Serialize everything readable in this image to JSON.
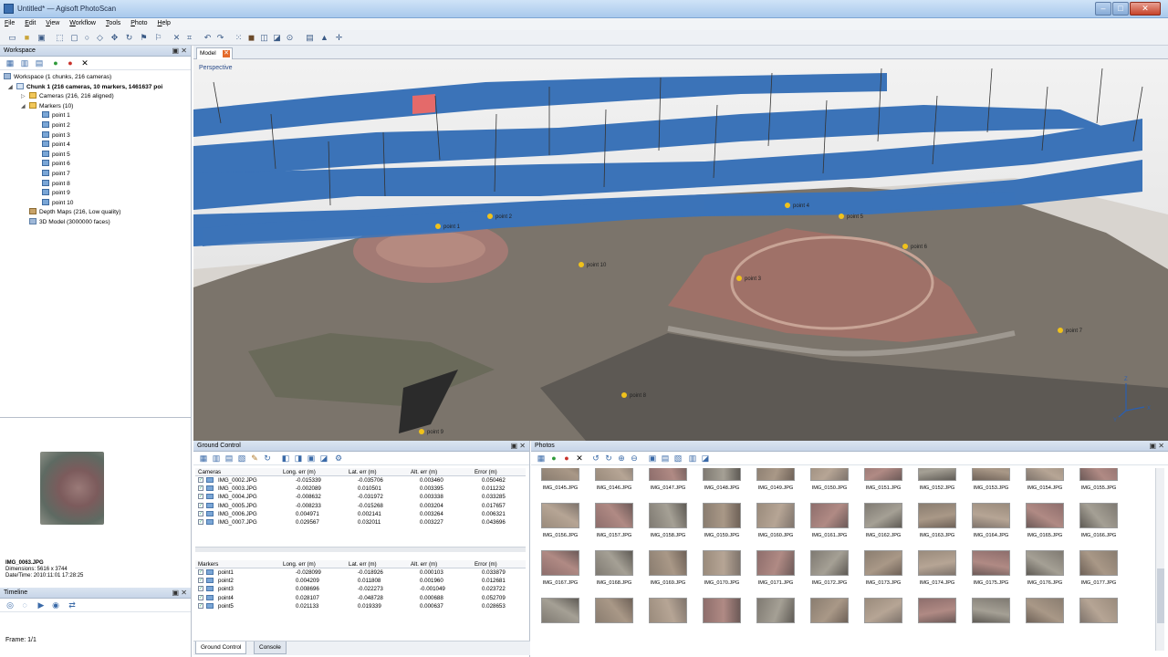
{
  "window": {
    "title": "Untitled* — Agisoft PhotoScan"
  },
  "menu": [
    "File",
    "Edit",
    "View",
    "Workflow",
    "Tools",
    "Photo",
    "Help"
  ],
  "workspace": {
    "title": "Workspace",
    "tree": [
      {
        "label": "Workspace (1 chunks, 216 cameras)",
        "level": 0,
        "bold": false
      },
      {
        "label": "Chunk 1 (216 cameras, 10 markers, 1461637 poi",
        "level": 1,
        "bold": true
      },
      {
        "label": "Cameras (216, 216 aligned)",
        "level": 2,
        "bold": false
      },
      {
        "label": "Markers (10)",
        "level": 2,
        "bold": false
      },
      {
        "label": "point 1",
        "level": 3,
        "bold": false
      },
      {
        "label": "point 2",
        "level": 3,
        "bold": false
      },
      {
        "label": "point 3",
        "level": 3,
        "bold": false
      },
      {
        "label": "point 4",
        "level": 3,
        "bold": false
      },
      {
        "label": "point 5",
        "level": 3,
        "bold": false
      },
      {
        "label": "point 6",
        "level": 3,
        "bold": false
      },
      {
        "label": "point 7",
        "level": 3,
        "bold": false
      },
      {
        "label": "point 8",
        "level": 3,
        "bold": false
      },
      {
        "label": "point 9",
        "level": 3,
        "bold": false
      },
      {
        "label": "point 10",
        "level": 3,
        "bold": false
      },
      {
        "label": "Depth Maps (216, Low quality)",
        "level": 2,
        "bold": false
      },
      {
        "label": "3D Model (3000000 faces)",
        "level": 2,
        "bold": false
      }
    ]
  },
  "preview": {
    "name": "IMG_0063.JPG",
    "dimensions": "Dimensions: 5616 x 3744",
    "datetime": "Date/Time: 2010:11:01 17:28:25"
  },
  "timeline": {
    "title": "Timeline",
    "frames": "Frame: 1/1"
  },
  "model": {
    "tab": "Model",
    "view_label": "Perspective"
  },
  "ground_control": {
    "title": "Ground Control",
    "cameras_headers": [
      "Cameras",
      "Long. err (m)",
      "Lat. err (m)",
      "Alt. err (m)",
      "Error (m)"
    ],
    "cameras_rows": [
      [
        "IMG_0002.JPG",
        "-0.015339",
        "-0.035706",
        "0.003460",
        "0.050462"
      ],
      [
        "IMG_0003.JPG",
        "-0.002089",
        "0.010501",
        "0.003395",
        "0.011232"
      ],
      [
        "IMG_0004.JPG",
        "-0.008632",
        "-0.031972",
        "0.003338",
        "0.033285"
      ],
      [
        "IMG_0005.JPG",
        "-0.008233",
        "-0.015268",
        "0.003204",
        "0.017657"
      ],
      [
        "IMG_0006.JPG",
        "0.004971",
        "0.002141",
        "0.003264",
        "0.006321"
      ],
      [
        "IMG_0007.JPG",
        "0.029567",
        "0.032011",
        "0.003227",
        "0.043696"
      ]
    ],
    "markers_headers": [
      "Markers",
      "Long. err (m)",
      "Lat. err (m)",
      "Alt. err (m)",
      "Error (m)"
    ],
    "markers_rows": [
      [
        "point1",
        "-0.028099",
        "-0.018926",
        "0.000103",
        "0.033879"
      ],
      [
        "point2",
        "0.004209",
        "0.011808",
        "0.001960",
        "0.012681"
      ],
      [
        "point3",
        "0.008696",
        "-0.022273",
        "-0.001049",
        "0.023722"
      ],
      [
        "point4",
        "0.028107",
        "-0.048728",
        "0.000688",
        "0.052709"
      ],
      [
        "point5",
        "0.021133",
        "0.019339",
        "0.000637",
        "0.028653"
      ]
    ],
    "tabs": [
      "Ground Control",
      "Console"
    ]
  },
  "photos": {
    "title": "Photos",
    "rows": [
      [
        "IMG_0145.JPG",
        "IMG_0146.JPG",
        "IMG_0147.JPG",
        "IMG_0148.JPG",
        "IMG_0149.JPG",
        "IMG_0150.JPG",
        "IMG_0151.JPG",
        "IMG_0152.JPG",
        "IMG_0153.JPG",
        "IMG_0154.JPG",
        "IMG_0155.JPG"
      ],
      [
        "IMG_0156.JPG",
        "IMG_0157.JPG",
        "IMG_0158.JPG",
        "IMG_0159.JPG",
        "IMG_0160.JPG",
        "IMG_0161.JPG",
        "IMG_0162.JPG",
        "IMG_0163.JPG",
        "IMG_0164.JPG",
        "IMG_0165.JPG",
        "IMG_0166.JPG"
      ],
      [
        "IMG_0167.JPG",
        "IMG_0168.JPG",
        "IMG_0169.JPG",
        "IMG_0170.JPG",
        "IMG_0171.JPG",
        "IMG_0172.JPG",
        "IMG_0173.JPG",
        "IMG_0174.JPG",
        "IMG_0175.JPG",
        "IMG_0176.JPG",
        "IMG_0177.JPG"
      ],
      [
        "",
        "",
        "",
        "",
        "",
        "",
        "",
        "",
        "",
        "",
        ""
      ]
    ]
  },
  "viewport_markers": [
    "point 1",
    "point 2",
    "point 3",
    "point 4",
    "point 5",
    "point 6",
    "point 7",
    "point 8",
    "point 9",
    "point 10"
  ]
}
